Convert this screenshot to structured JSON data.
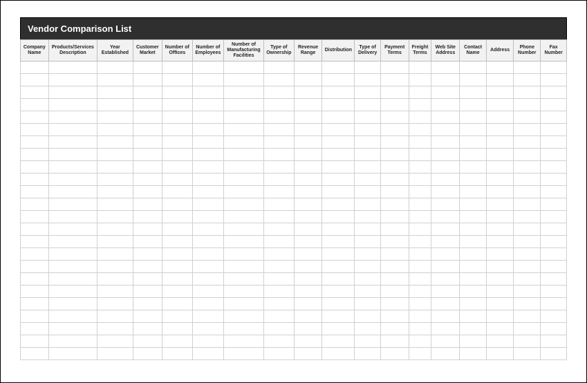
{
  "title": "Vendor Comparison List",
  "columns": [
    "Company Name",
    "Products/Services Description",
    "Year Established",
    "Customer Market",
    "Number of Offices",
    "Number of Employees",
    "Number of Manufacturing Facilities",
    "Type of Ownership",
    "Revenue Range",
    "Distribution",
    "Type of Delivery",
    "Payment Terms",
    "Freight Terms",
    "Web Site Address",
    "Contact Name",
    "Address",
    "Phone Number",
    "Fax Number"
  ],
  "row_count": 24
}
